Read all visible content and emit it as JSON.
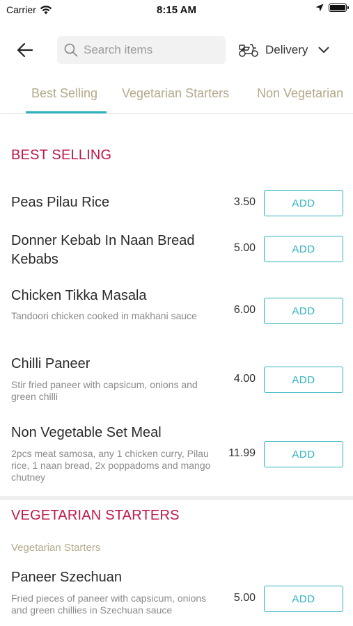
{
  "status_bar": {
    "carrier": "Carrier",
    "time": "8:15 AM",
    "icons": [
      "wifi-icon",
      "location-arrow-icon",
      "battery-icon"
    ]
  },
  "top_bar": {
    "back_icon": "arrow-left-icon",
    "search_placeholder": "Search items",
    "search_value": "",
    "delivery_label": "Delivery",
    "delivery_icon": "scooter-icon"
  },
  "tabs": [
    {
      "label": "Best Selling",
      "active": true
    },
    {
      "label": "Vegetarian Starters",
      "active": false
    },
    {
      "label": "Non Vegetarian",
      "active": false
    }
  ],
  "colors": {
    "accent": "#2bb3c0",
    "section_title": "#c0174a",
    "tab_text": "#b3a98a"
  },
  "sections": [
    {
      "title": "BEST SELLING",
      "items": [
        {
          "name": "Peas Pilau Rice",
          "description": "",
          "price": "3.50",
          "button": "ADD"
        },
        {
          "name": "Donner Kebab In Naan Bread Kebabs",
          "description": "",
          "price": "5.00",
          "button": "ADD"
        },
        {
          "name": "Chicken Tikka Masala",
          "description": "Tandoori chicken cooked in makhani sauce",
          "price": "6.00",
          "button": "ADD"
        },
        {
          "name": "Chilli Paneer",
          "description": "Stir fried paneer with capsicum, onions and green chilli",
          "price": "4.00",
          "button": "ADD"
        },
        {
          "name": "Non Vegetable Set Meal",
          "description": "2pcs meat samosa, any 1 chicken curry, Pilau rice, 1 naan bread, 2x poppadoms and mango chutney",
          "price": "11.99",
          "button": "ADD"
        }
      ]
    },
    {
      "title": "VEGETARIAN STARTERS",
      "subcategory": "Vegetarian Starters",
      "items": [
        {
          "name": "Paneer Szechuan",
          "description": "Fried pieces of paneer with capsicum, onions and green chillies in Szechuan sauce",
          "price": "5.00",
          "button": "ADD"
        }
      ]
    }
  ]
}
